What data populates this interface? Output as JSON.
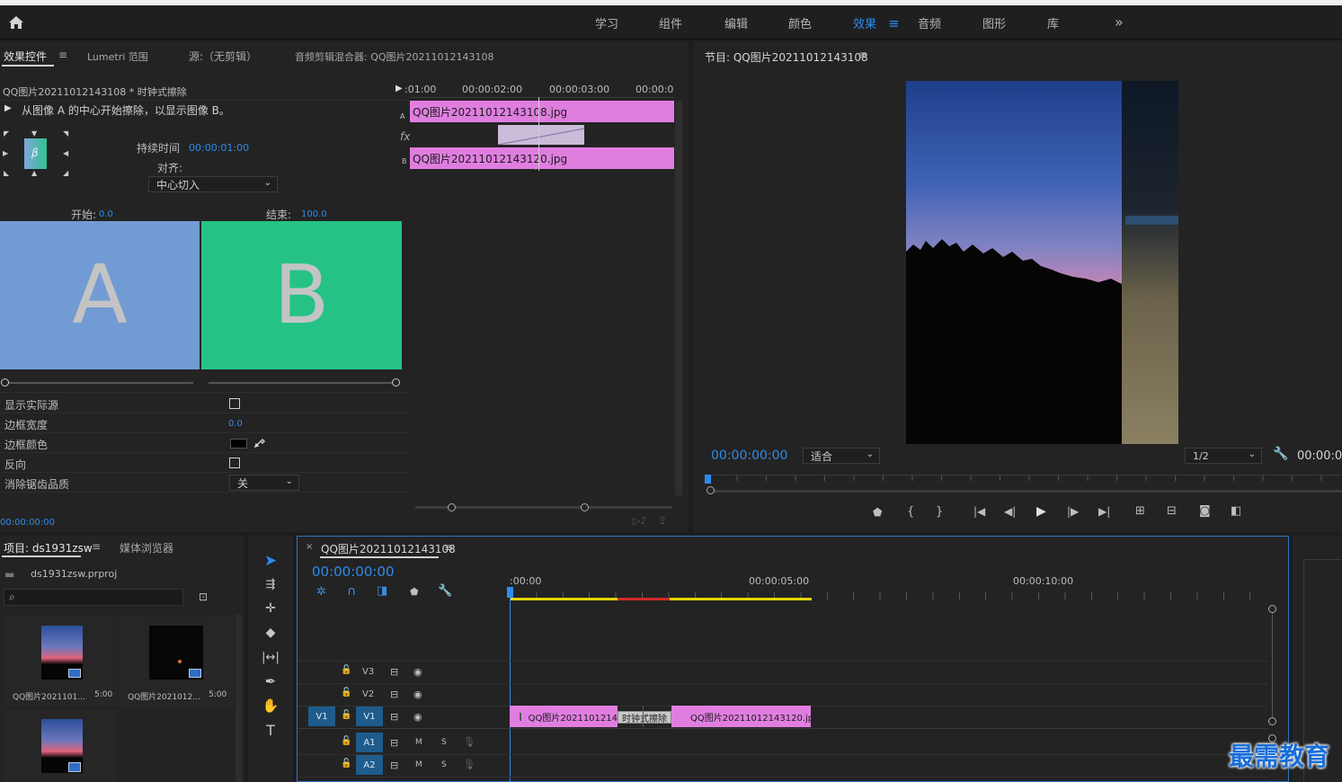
{
  "workspaces": {
    "items": [
      "学习",
      "组件",
      "编辑",
      "颜色",
      "效果",
      "音频",
      "图形",
      "库"
    ],
    "active": "效果",
    "more": "»"
  },
  "effect_controls": {
    "tabs": [
      "效果控件",
      "Lumetri 范围",
      "源:（无剪辑）",
      "音频剪辑混合器: QQ图片20211012143108"
    ],
    "clip_header": "QQ图片20211012143108 * 时钟式擦除",
    "description": "从图像 A 的中心开始擦除，以显示图像 B。",
    "duration_label": "持续时间",
    "duration_value": "00:00:01:00",
    "align_label": "对齐:",
    "align_value": "中心切入",
    "start_label": "开始:",
    "start_value": "0.0",
    "end_label": "结束:",
    "end_value": "100.0",
    "preview_a": "A",
    "preview_b": "B",
    "color_a": "#739bd3",
    "color_b": "#26c285",
    "properties": [
      {
        "label": "显示实际源",
        "type": "checkbox"
      },
      {
        "label": "边框宽度",
        "type": "number",
        "value": "0.0"
      },
      {
        "label": "边框颜色",
        "type": "color"
      },
      {
        "label": "反向",
        "type": "checkbox"
      },
      {
        "label": "消除锯齿品质",
        "type": "select",
        "value": "关"
      }
    ],
    "bottom_timecode": "00:00:00:00",
    "mini_timeline": {
      "ticks": [
        ":01:00",
        "00:00:02:00",
        "00:00:03:00",
        "00:00:0"
      ],
      "track_a": "A",
      "track_b": "B",
      "fx_label": "fx",
      "clip_a": "QQ图片20211012143108.jpg",
      "clip_b": "QQ图片20211012143120.jpg"
    }
  },
  "program_monitor": {
    "title": "节目: QQ图片20211012143108",
    "timecode": "00:00:00:00",
    "fit_value": "适合",
    "resolution_value": "1/2",
    "end_timecode": "00:00:0"
  },
  "project": {
    "tabs": [
      "项目: ds1931zsw",
      "媒体浏览器"
    ],
    "file": "ds1931zsw.prproj",
    "items": [
      {
        "name": "QQ图片2021101...",
        "duration": "5:00"
      },
      {
        "name": "QQ图片2021012...",
        "duration": "5:00"
      },
      {
        "name": "",
        "duration": ""
      }
    ]
  },
  "timeline": {
    "tab_title": "QQ图片20211012143108",
    "timecode": "00:00:00:00",
    "ruler": [
      ":00:00",
      "00:00:05:00",
      "00:00:10:00"
    ],
    "video_tracks": [
      "V3",
      "V2",
      "V1"
    ],
    "audio_tracks": [
      "A1",
      "A2"
    ],
    "source_patch": "V1",
    "mute": "M",
    "solo": "S",
    "clip_1": "QQ图片2021101214",
    "transition": "时钟式擦除",
    "clip_2": "QQ图片20211012143120.jpg"
  },
  "watermark": "最需教育"
}
